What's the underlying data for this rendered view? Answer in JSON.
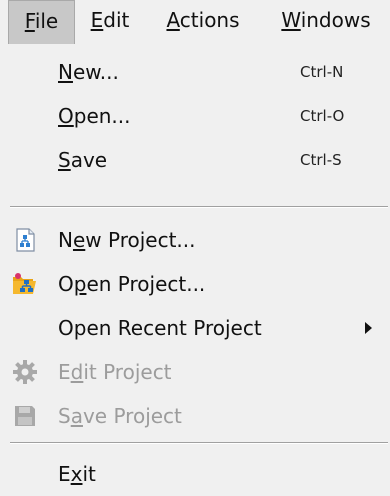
{
  "menubar": {
    "file": "File",
    "edit": "Edit",
    "actions": "Actions",
    "windows": "Windows"
  },
  "menu": {
    "new": {
      "label": "New...",
      "shortcut": "Ctrl-N"
    },
    "open": {
      "label": "Open...",
      "shortcut": "Ctrl-O"
    },
    "save": {
      "label": "Save",
      "shortcut": "Ctrl-S"
    },
    "new_project": {
      "label": "New Project...",
      "icon": "new-project-icon"
    },
    "open_project": {
      "label": "Open Project...",
      "icon": "open-project-icon"
    },
    "open_recent": {
      "label": "Open Recent Project",
      "icon": "submenu-arrow-icon"
    },
    "edit_project": {
      "label": "Edit Project",
      "icon": "gear-icon",
      "disabled": true
    },
    "save_project": {
      "label": "Save Project",
      "icon": "floppy-disk-icon",
      "disabled": true
    },
    "exit": {
      "label": "Exit"
    }
  }
}
